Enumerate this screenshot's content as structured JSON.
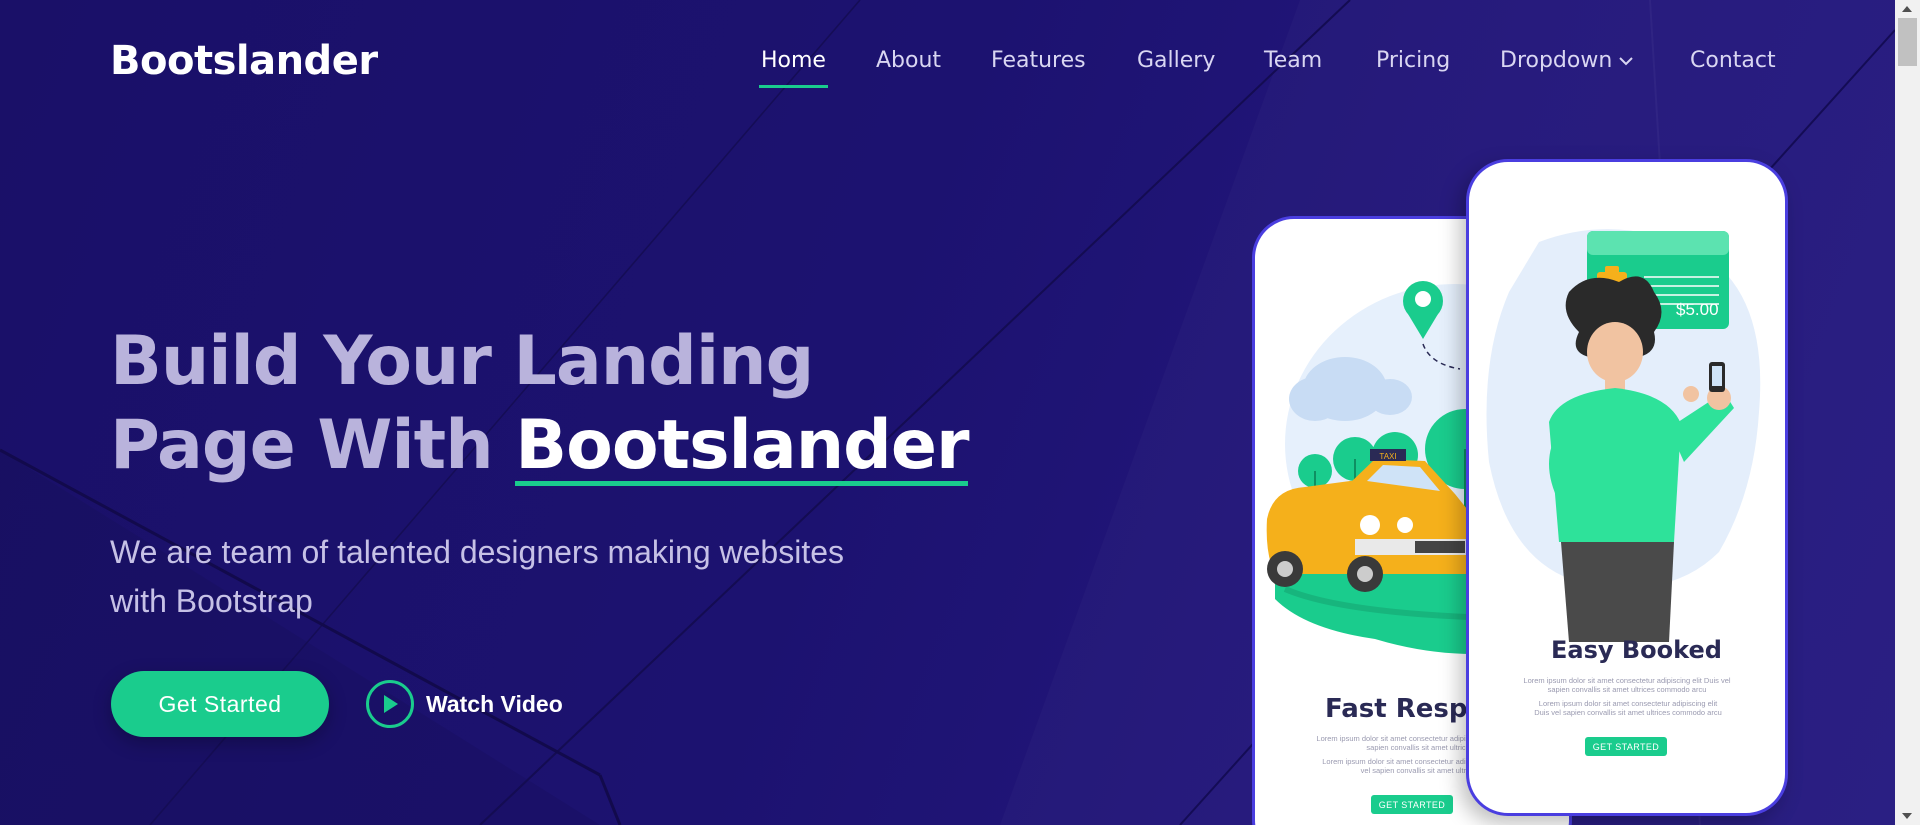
{
  "brand": "Bootslander",
  "nav": {
    "items": [
      "Home",
      "About",
      "Features",
      "Gallery",
      "Team",
      "Pricing",
      "Dropdown",
      "Contact"
    ],
    "active": "Home"
  },
  "hero": {
    "title_line1": "Build Your Landing",
    "title_line2_prefix": "Page With",
    "title_accent": "Bootslander",
    "subtitle": "We are team of talented designers making websites with Bootstrap",
    "cta_label": "Get Started",
    "video_label": "Watch Video"
  },
  "phones": {
    "back": {
      "title": "Fast Respon",
      "body_1": "Lorem ipsum dolor sit amet consectetur adipiscing elit Duis vel sapien convallis sit amet ultrices",
      "body_2": "Lorem ipsum dolor sit amet consectetur adipiscing elit Duis vel sapien convallis sit amet ultrices",
      "button": "GET STARTED",
      "taxi_sign": "TAXI"
    },
    "front": {
      "title": "Easy Booked",
      "body_1": "Lorem ipsum dolor sit amet consectetur adipiscing elit Duis vel sapien convallis sit amet ultrices commodo arcu",
      "body_2": "Lorem ipsum dolor sit amet consectetur adipiscing elit Duis vel sapien convallis sit amet ultrices commodo arcu",
      "button": "GET STARTED",
      "price": "$5.00"
    }
  },
  "colors": {
    "background": "#1c1270",
    "accent": "#1acc8d",
    "phone_border": "#4a3ee0"
  },
  "icons": [
    "chevron-down-icon",
    "play-icon",
    "location-pin-icon"
  ]
}
